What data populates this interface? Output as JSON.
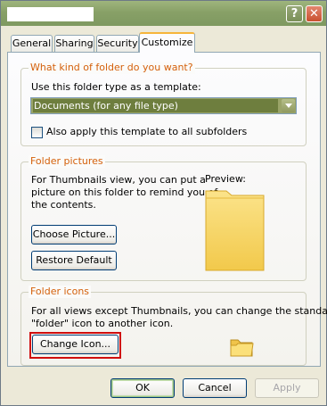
{
  "tabs": [
    {
      "label": "General"
    },
    {
      "label": "Sharing"
    },
    {
      "label": "Security"
    },
    {
      "label": "Customize",
      "active": true
    }
  ],
  "titlebar": {
    "help_glyph": "?",
    "close_glyph": "✕"
  },
  "folder_type_group": {
    "legend": "What kind of folder do you want?",
    "template_label": "Use this folder type as a template:",
    "template_value": "Documents (for any file type)",
    "apply_subfolders_label": "Also apply this template to all subfolders",
    "apply_subfolders_checked": false
  },
  "folder_pictures_group": {
    "legend": "Folder pictures",
    "description_line1": "For Thumbnails view, you can put a",
    "description_line2": "picture on this folder to remind you of",
    "description_line3": "the contents.",
    "preview_label": "Preview:",
    "choose_picture_label": "Choose Picture...",
    "restore_default_label": "Restore Default",
    "preview_icon": "folder-icon"
  },
  "folder_icons_group": {
    "legend": "Folder icons",
    "description_line1": "For all views except Thumbnails, you can change the standard",
    "description_line2": "\"folder\" icon to another icon.",
    "change_icon_label": "Change Icon...",
    "icon": "folder-small-icon"
  },
  "footer": {
    "ok_label": "OK",
    "cancel_label": "Cancel",
    "apply_label": "Apply",
    "apply_enabled": false
  },
  "colors": {
    "accent_title_bar": "#88a067",
    "legend_text": "#d4600b",
    "highlight_box": "#d00d0d",
    "folder_yellow": "#f7d35a"
  }
}
